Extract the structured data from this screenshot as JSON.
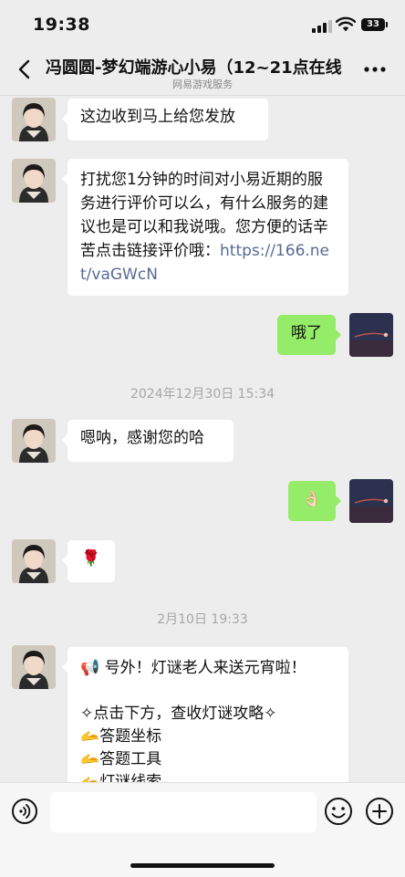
{
  "status_bar": {
    "time": "19:38",
    "battery": "33"
  },
  "nav": {
    "title": "冯圆圆-梦幻端游心小易（12~21点在线",
    "subtitle": "网易游戏服务"
  },
  "messages": {
    "m1": "这边收到马上给您发放",
    "m2_text": "打扰您1分钟的时间对小易近期的服务进行评价可以么，有什么服务的建议也是可以和我说哦。您方便的话辛苦点击链接评价哦：",
    "m2_link": "https://166.net/vaGWcN",
    "m3": "哦了",
    "ts1": "2024年12月30日 15:34",
    "m4": "嗯呐，感谢您的哈",
    "m5": "👌🏻",
    "m6": "🌹",
    "ts2": "2月10日 19:33",
    "m7_l1": "📢 号外！灯谜老人来送元宵啦！",
    "m7_l2": "✧点击下方，查收灯谜攻略✧",
    "m7_l3": "🫴答题坐标",
    "m7_l4": "🫴答题工具",
    "m7_l5": "🫴灯谜线索"
  },
  "icons": {
    "back": "chevron-left-icon",
    "more": "more-dots-icon",
    "voice": "voice-icon",
    "emoji": "emoji-icon",
    "plus": "plus-icon"
  },
  "colors": {
    "background": "#ededed",
    "incoming_bubble": "#ffffff",
    "outgoing_bubble": "#95ec69",
    "link": "#576b95"
  }
}
